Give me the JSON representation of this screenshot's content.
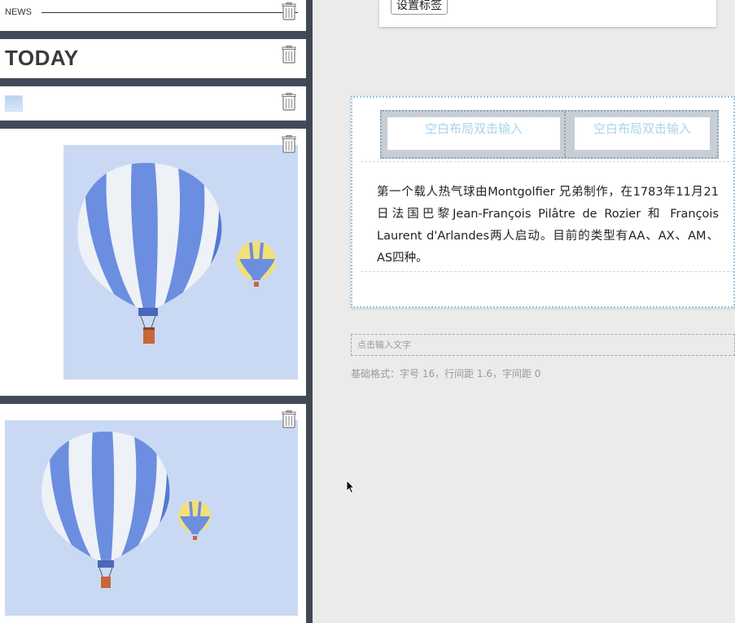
{
  "left_panel": {
    "news_label": "NEWS",
    "today_title": "TODAY",
    "colors": {
      "panel_bg": "#444a59",
      "photo_bg": "#cad9f3",
      "balloon_blue": "#6b8ee0",
      "balloon_white": "#eef1f6",
      "swatch": "#c2d9f2"
    },
    "icons": [
      "trash-icon",
      "hot-air-balloon-image"
    ]
  },
  "editor": {
    "tag_button": "设置标签",
    "grid_placeholder_left": "空白布局双击输入",
    "grid_placeholder_right": "空白布局双击输入",
    "paragraph": "第一个载人热气球由Montgolfier 兄弟制作，在1783年11月21日法国巴黎Jean-François Pilâtre de Rozier 和 François Laurent d'Arlandes两人启动。目前的类型有AA、AX、AM、AS四种。",
    "input_placeholder": "点击输入文字",
    "base_format": "基础格式：字号 16，行间距 1.6，字间距 0"
  }
}
